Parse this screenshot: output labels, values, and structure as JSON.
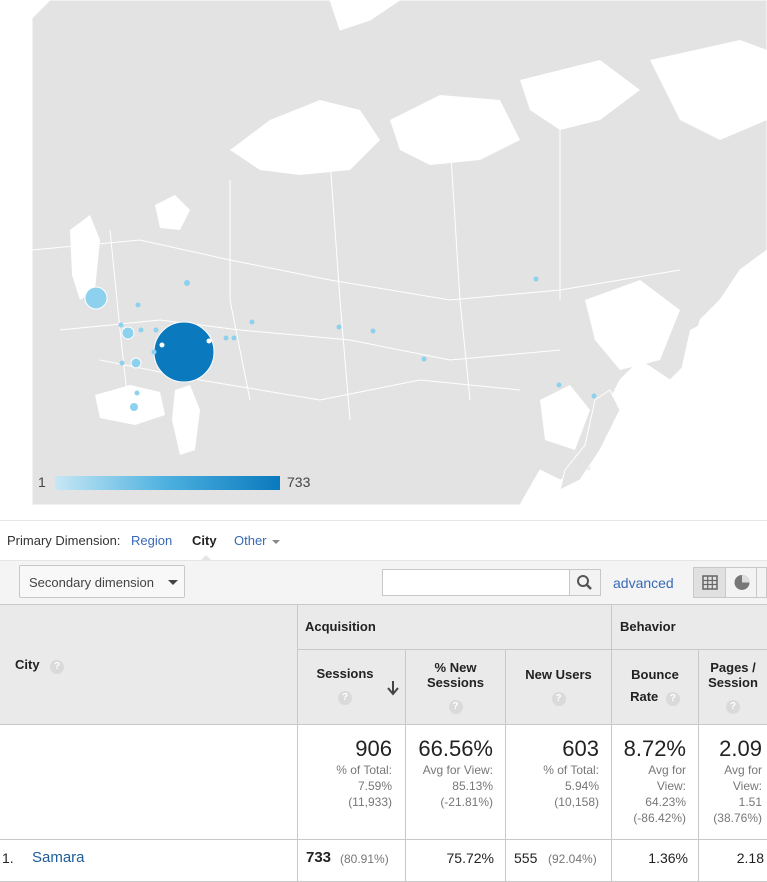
{
  "map": {
    "legend_min": "1",
    "legend_max": "733",
    "colors": {
      "land": "#e3e3e3",
      "border": "#ffffff",
      "bubble_big": "#0a79bd",
      "bubble_small": "#8ed1ee"
    }
  },
  "dimensions": {
    "label": "Primary Dimension:",
    "region": "Region",
    "city": "City",
    "other": "Other"
  },
  "toolbar": {
    "secondary_dimension": "Secondary dimension",
    "search_placeholder": "",
    "advanced": "advanced"
  },
  "table": {
    "headers": {
      "city": "City",
      "acquisition": "Acquisition",
      "behavior": "Behavior",
      "sessions": "Sessions",
      "pct_new_sessions_1": "% New",
      "pct_new_sessions_2": "Sessions",
      "new_users": "New Users",
      "bounce_1": "Bounce",
      "bounce_2": "Rate",
      "pages_1": "Pages /",
      "pages_2": "Session"
    },
    "totals": {
      "sessions": "906",
      "sessions_sub": [
        "% of Total:",
        "7.59%",
        "(11,933)"
      ],
      "pct_new": "66.56%",
      "pct_new_sub": [
        "Avg for View:",
        "85.13%",
        "(-21.81%)"
      ],
      "new_users": "603",
      "new_users_sub": [
        "% of Total:",
        "5.94%",
        "(10,158)"
      ],
      "bounce": "8.72%",
      "bounce_sub": [
        "Avg for",
        "View:",
        "64.23%",
        "(-86.42%)"
      ],
      "pages": "2.09",
      "pages_sub": [
        "Avg for",
        "View:",
        "1.51",
        "(38.76%)"
      ]
    },
    "rows": [
      {
        "index": "1.",
        "city": "Samara",
        "sessions": "733",
        "sessions_pct": "(80.91%)",
        "pct_new": "75.72%",
        "new_users": "555",
        "new_users_pct": "(92.04%)",
        "bounce": "1.36%",
        "pages": "2.18"
      }
    ]
  }
}
